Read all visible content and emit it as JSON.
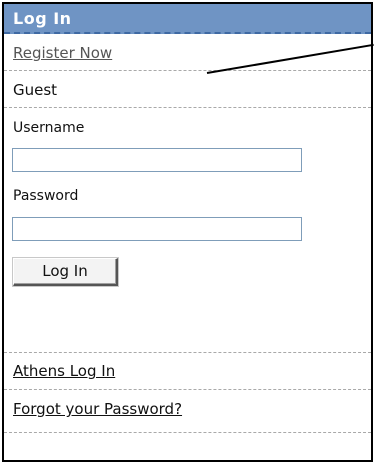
{
  "login_panel": {
    "title": "Log In",
    "register_link": "Register Now",
    "user_status": "Guest",
    "username_label": "Username",
    "username_value": "",
    "password_label": "Password",
    "password_value": "",
    "submit_label": "Log In",
    "athens_link": "Athens Log In",
    "forgot_link": "Forgot your Password?"
  },
  "colors": {
    "header_bg": "#6f94c4",
    "header_text": "#ffffff",
    "border": "#000000",
    "divider": "#a9a9a9"
  },
  "icons": []
}
